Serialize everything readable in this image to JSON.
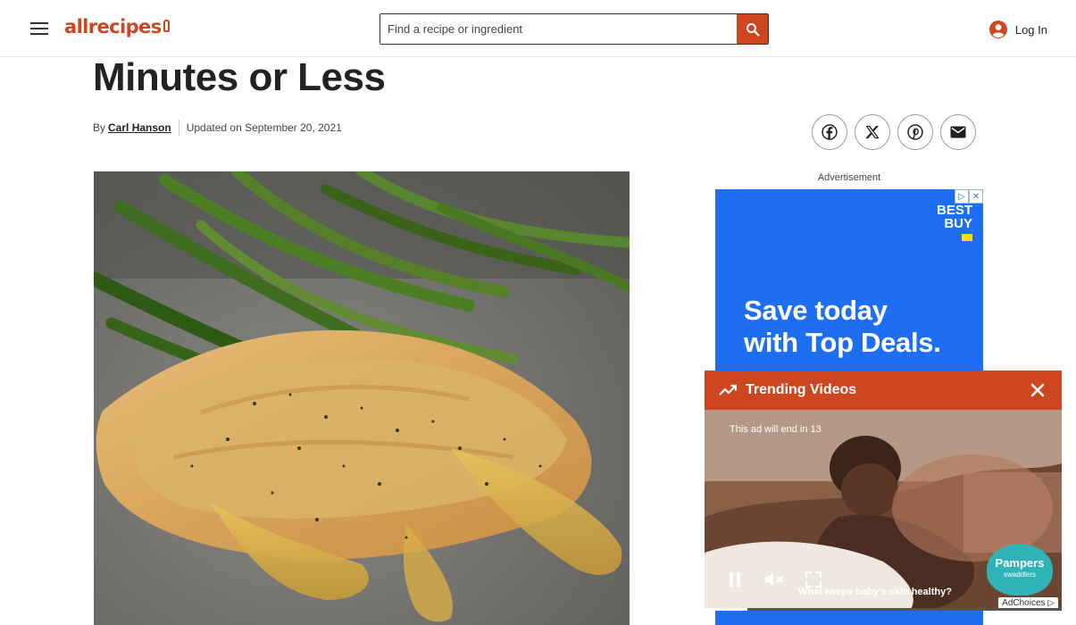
{
  "header": {
    "logo_text": "allrecipes",
    "search_placeholder": "Find a recipe or ingredient",
    "login_label": "Log In"
  },
  "article": {
    "title": "Minutes or Less",
    "by_label": "By",
    "author": "Carl Hanson",
    "updated": "Updated on September 20, 2021"
  },
  "share": {
    "icons": [
      "facebook-icon",
      "x-icon",
      "pinterest-icon",
      "email-icon"
    ]
  },
  "ad": {
    "label": "Advertisement",
    "brand_line1": "BEST",
    "brand_line2": "BUY",
    "headline_line1": "Save today",
    "headline_line2": "with Top Deals."
  },
  "video": {
    "bar_title": "Trending Videos",
    "ad_timer": "This ad will end in 13",
    "caption": "What keeps baby's skin healthy?",
    "sponsor_line1": "Pampers",
    "sponsor_line2": "swaddlers",
    "adchoices": "AdChoices",
    "progress": 0.12
  },
  "colors": {
    "brand": "#ce4620",
    "ad_blue": "#1d6ef2"
  }
}
